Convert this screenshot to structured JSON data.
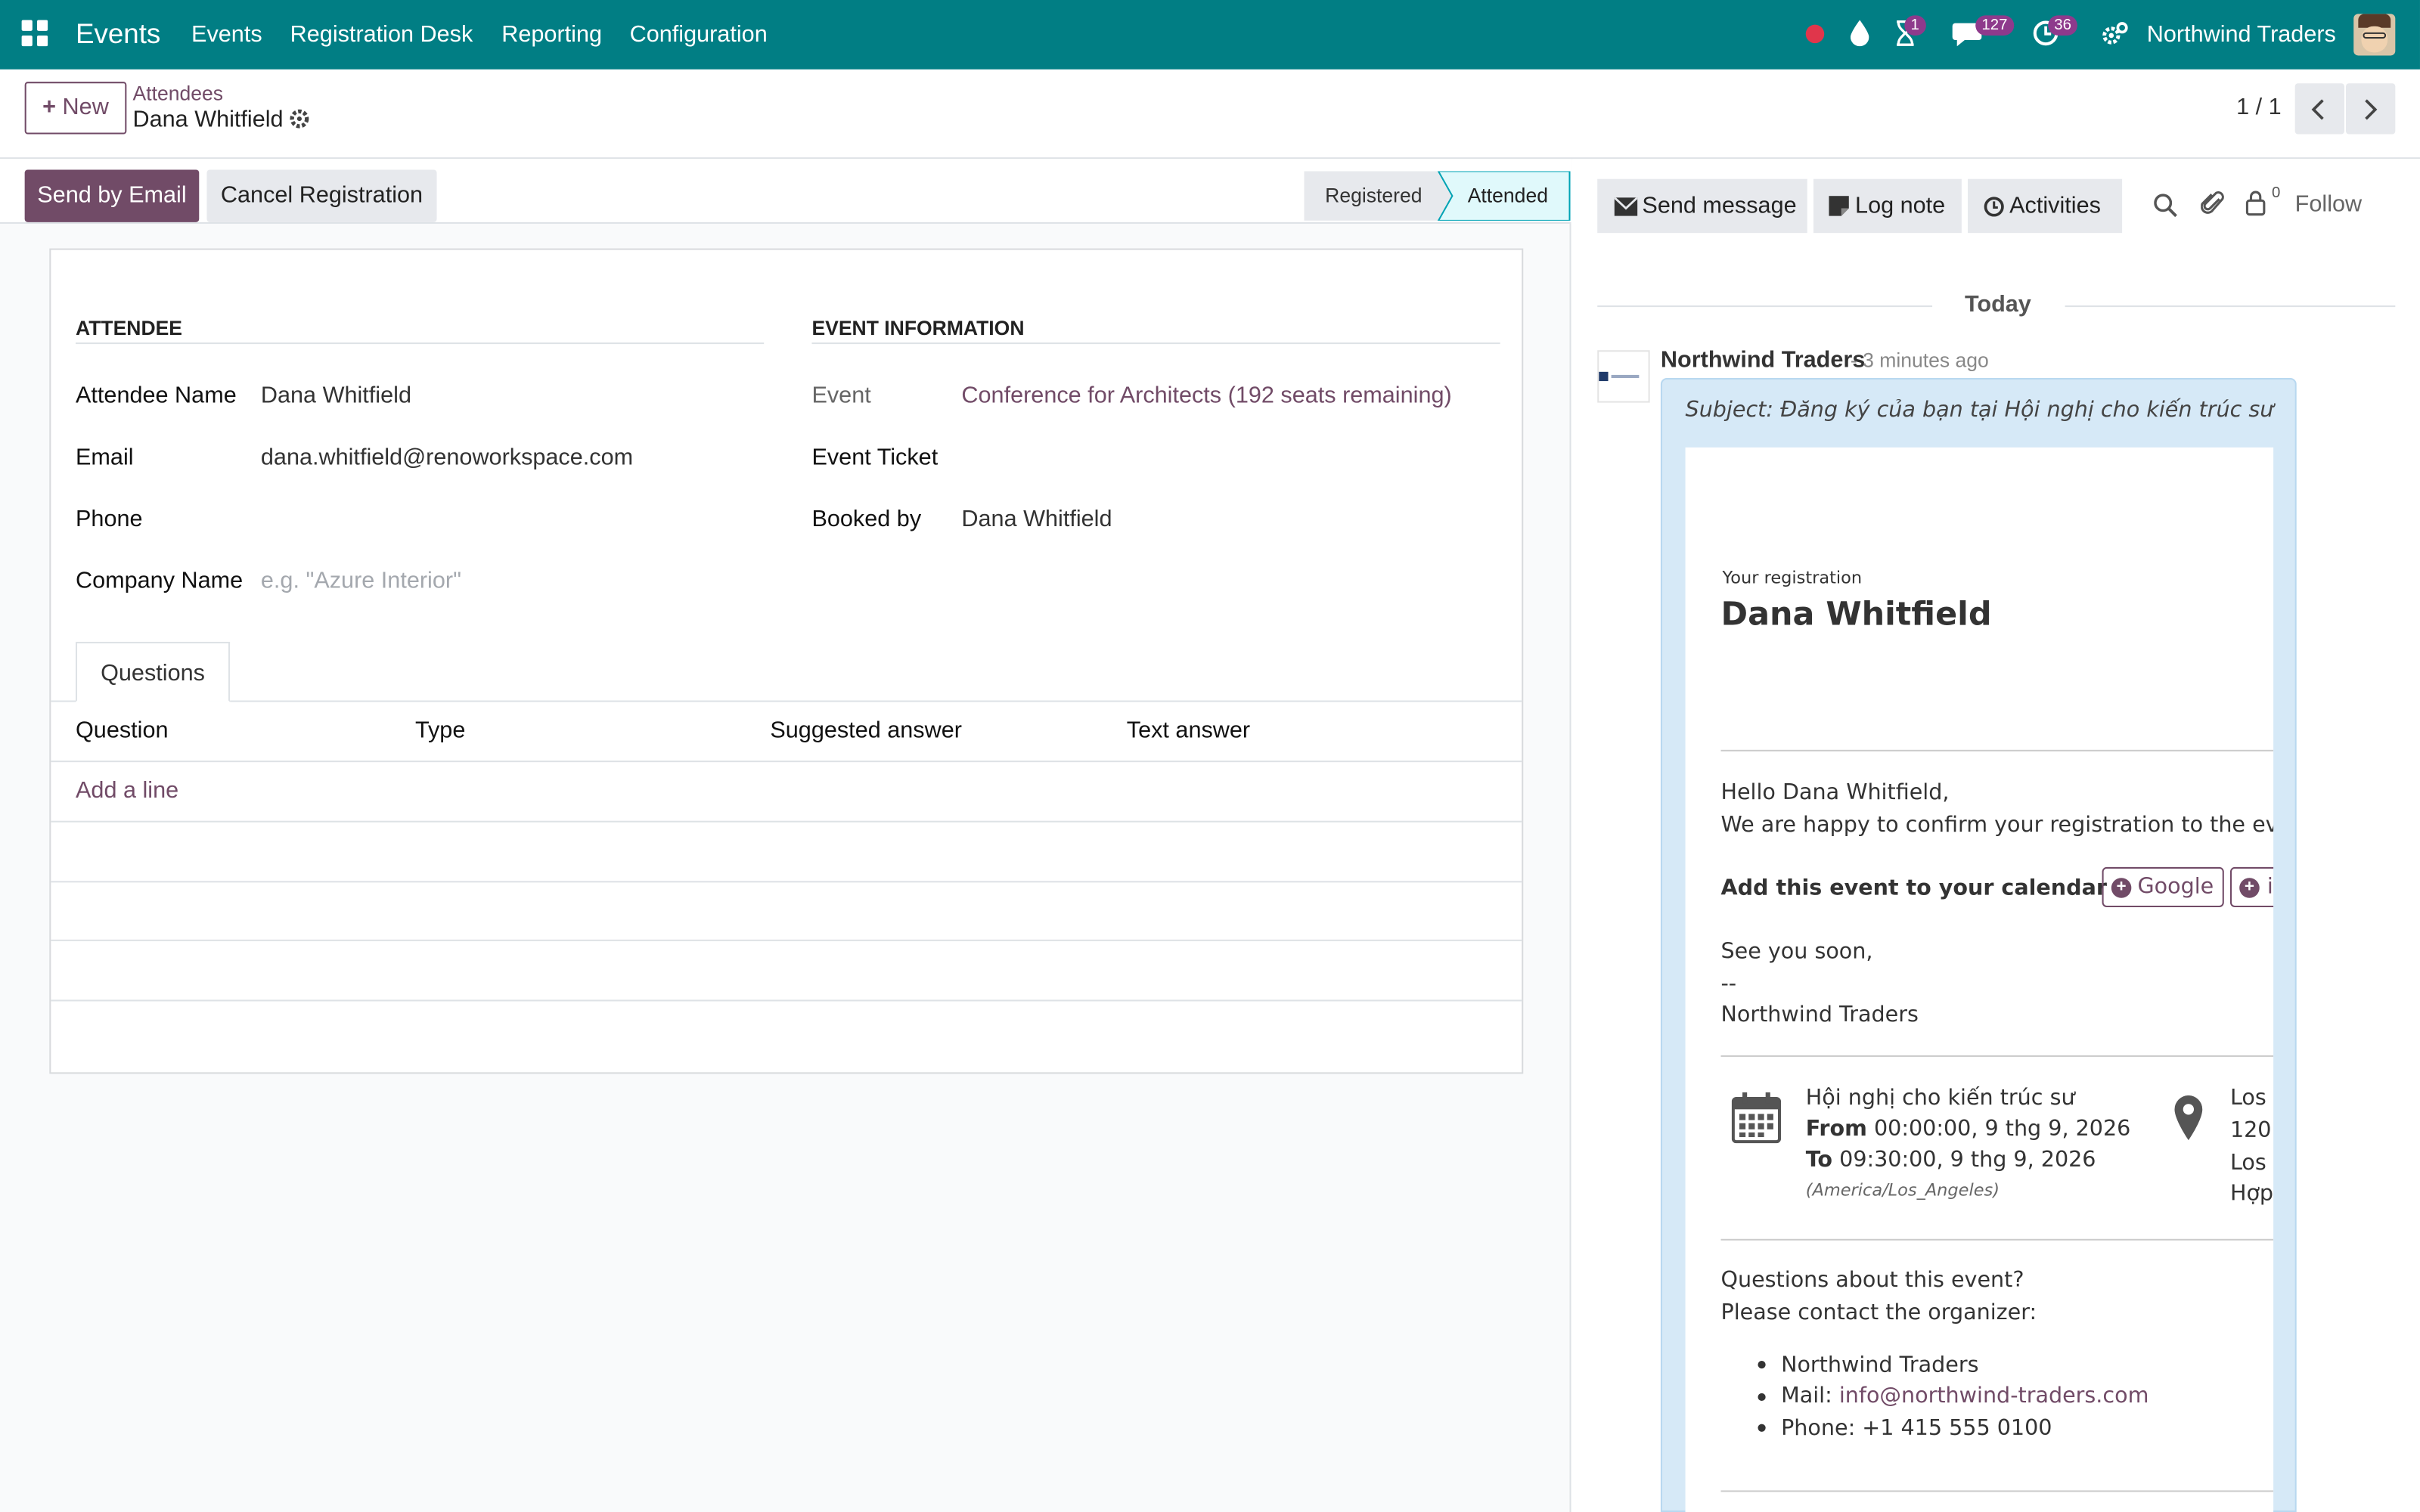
{
  "navbar": {
    "app_name": "Events",
    "menu": [
      "Events",
      "Registration Desk",
      "Reporting",
      "Configuration"
    ],
    "badges": {
      "activities": "1",
      "messages": "127",
      "clock": "36"
    },
    "company": "Northwind Traders",
    "icons": [
      "apps-grid-icon",
      "status-dot-icon",
      "drop-icon",
      "hourglass-icon",
      "chat-icon",
      "clock-icon",
      "settings-icon",
      "avatar"
    ]
  },
  "control": {
    "new_label": "New",
    "breadcrumb_parent": "Attendees",
    "breadcrumb_current": "Dana Whitfield",
    "pager": "1 / 1"
  },
  "statusbar": {
    "send_email": "Send by Email",
    "cancel": "Cancel Registration",
    "stages": [
      "Registered",
      "Attended"
    ],
    "active_stage": "Attended"
  },
  "form": {
    "attendee_header": "ATTENDEE",
    "event_header": "EVENT INFORMATION",
    "attendee_name_label": "Attendee Name",
    "attendee_name": "Dana Whitfield",
    "email_label": "Email",
    "email": "dana.whitfield@renoworkspace.com",
    "phone_label": "Phone",
    "phone": "",
    "company_label": "Company Name",
    "company_placeholder": "e.g. \"Azure Interior\"",
    "event_label": "Event",
    "event": "Conference for Architects (192 seats remaining)",
    "ticket_label": "Event Ticket",
    "ticket": "",
    "booked_by_label": "Booked by",
    "booked_by": "Dana Whitfield",
    "tab": "Questions",
    "columns": [
      "Question",
      "Type",
      "Suggested answer",
      "Text answer"
    ],
    "add_line": "Add a line"
  },
  "chatter": {
    "send_message": "Send message",
    "log_note": "Log note",
    "activities": "Activities",
    "followers_count": "0",
    "follow": "Follow",
    "date_separator": "Today",
    "author": "Northwind Traders",
    "time": "- 3 minutes ago",
    "subject": "Subject: Đăng ký của bạn tại Hội nghị cho kiến trúc sư",
    "mail": {
      "reg_small": "Your registration",
      "reg_name": "Dana Whitfield",
      "hello": "Hello Dana Whitfield,",
      "happy": "We are happy to confirm your registration to the ev",
      "calendar_label": "Add this event to your calendar",
      "google": "Google",
      "ical": "i",
      "see_you": "See you soon,",
      "dash": "--",
      "signature": "Northwind Traders",
      "event_name": "Hội nghị cho kiến trúc sư",
      "from_label": "From",
      "from_value": " 00:00:00, 9 thg 9, 2026",
      "to_label": "To",
      "to_value": " 09:30:00, 9 thg 9, 2026",
      "tz": "(America/Los_Angeles)",
      "loc": [
        "Los",
        "120",
        "Los",
        "Hợp"
      ],
      "questions": "Questions about this event?",
      "contact": "Please contact the organizer:",
      "org_name": "Northwind Traders",
      "mail_label": "Mail: ",
      "mail_value": "info@northwind-traders.com",
      "phone": "Phone: +1 415 555 0100"
    }
  },
  "colors": {
    "navbar": "#017e84",
    "primary": "#714b67",
    "link": "#714b67",
    "active_stage": "#e0f9fb",
    "badge": "#8e3a8c"
  }
}
